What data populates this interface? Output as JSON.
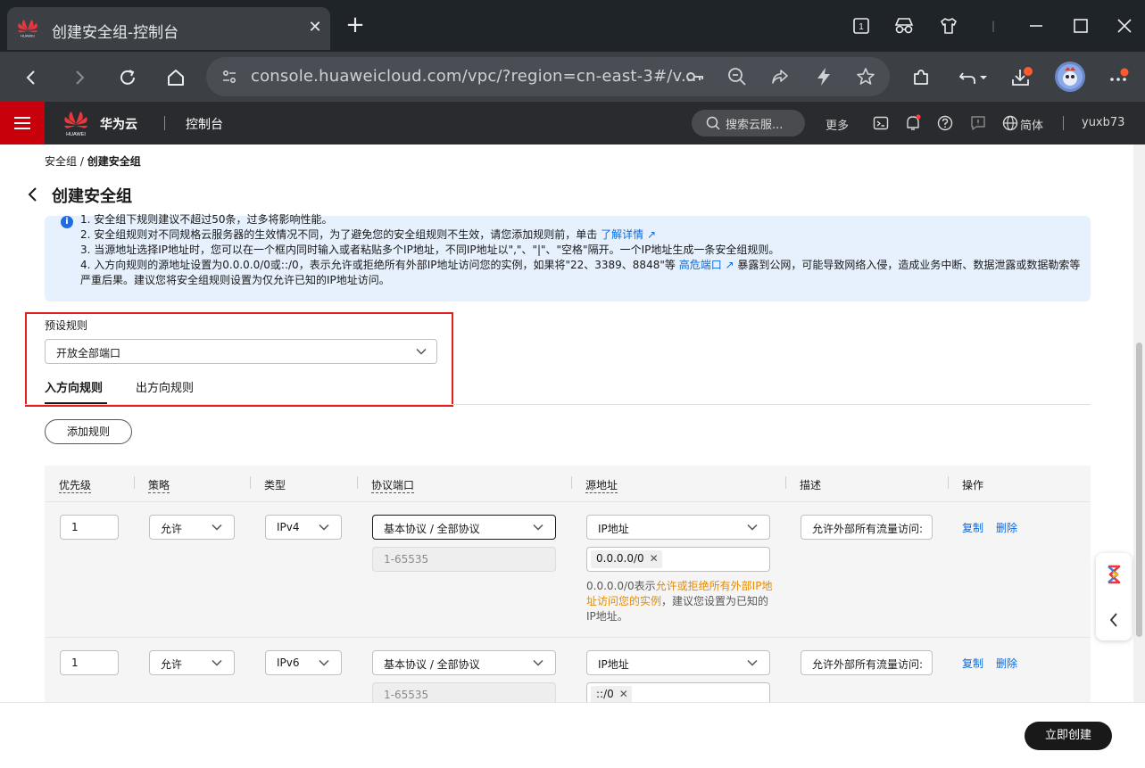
{
  "browser": {
    "tab_title": "创建安全组-控制台",
    "tab_count": "1",
    "url": "console.huaweicloud.com/vpc/?region=cn-east-3#/v..."
  },
  "console_header": {
    "brand": "华为云",
    "logo_text": "HUAWEI",
    "console": "控制台",
    "search_placeholder": "搜索云服...",
    "more": "更多",
    "language": "简体",
    "username": "yuxb73"
  },
  "page": {
    "breadcrumb_parent": "安全组",
    "breadcrumb_sep": " / ",
    "breadcrumb_current": "创建安全组",
    "title": "创建安全组"
  },
  "notice": {
    "line1": "1. 安全组下规则建议不超过50条，过多将影响性能。",
    "line2": "2. 安全组规则对不同规格云服务器的生效情况不同，为了避免您的安全组规则不生效，请您添加规则前，单击",
    "line2_link": "了解详情",
    "line3": "3. 当源地址选择IP地址时，您可以在一个框内同时输入或者粘贴多个IP地址，不同IP地址以\",\"、\"|\"、\"空格\"隔开。一个IP地址生成一条安全组规则。",
    "line4a": "4. 入方向规则的源地址设置为0.0.0.0/0或::/0，表示允许或拒绝所有外部IP地址访问您的实例，如果将\"22、3389、8848\"等",
    "line4_link": "高危端口",
    "line4b": "暴露到公网，可能导致网络入侵，造成业务中断、数据泄露或数据勒索等",
    "line5": "严重后果。建议您将安全组规则设置为仅允许已知的IP地址访问。"
  },
  "preset": {
    "label": "预设规则",
    "value": "开放全部端口"
  },
  "tabs": {
    "inbound": "入方向规则",
    "outbound": "出方向规则"
  },
  "add_rule": "添加规则",
  "table": {
    "headers": {
      "priority": "优先级",
      "policy": "策略",
      "type": "类型",
      "protocol_port": "协议端口",
      "source": "源地址",
      "description": "描述",
      "action": "操作"
    },
    "rows": [
      {
        "priority": "1",
        "policy": "允许",
        "type": "IPv4",
        "protocol": "基本协议 / 全部协议",
        "port": "1-65535",
        "source_type": "IP地址",
        "source_value": "0.0.0.0/0",
        "hint_a": "0.0.0.0/0表示",
        "hint_warn1": "允许或拒绝所有外部IP地",
        "hint_warn2": "址访问您的实例",
        "hint_b": "，建议您设置为已知的",
        "hint_c": "IP地址。",
        "description": "允许外部所有流量访问:",
        "copy": "复制",
        "delete": "删除"
      },
      {
        "priority": "1",
        "policy": "允许",
        "type": "IPv6",
        "protocol": "基本协议 / 全部协议",
        "port": "1-65535",
        "source_type": "IP地址",
        "source_value": "::/0",
        "description": "允许外部所有流量访问:",
        "copy": "复制",
        "delete": "删除"
      }
    ]
  },
  "footer": {
    "create": "立即创建"
  },
  "colors": {
    "brand_red": "#c7000b",
    "link_blue": "#0a6ade",
    "warning_orange": "#e88a00",
    "notice_bg": "#e6f1fd",
    "highlight_box": "#e02020"
  }
}
